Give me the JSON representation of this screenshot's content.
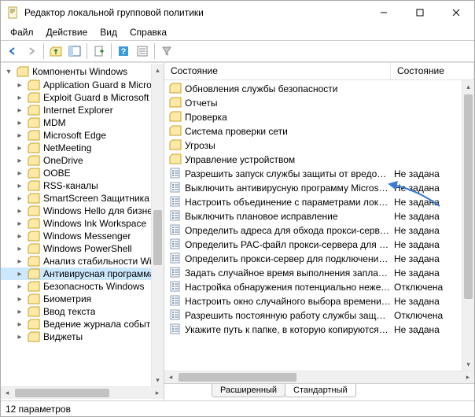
{
  "window": {
    "title": "Редактор локальной групповой политики",
    "minimize": "—",
    "maximize": "☐",
    "close": "✕"
  },
  "menu": {
    "file": "Файл",
    "action": "Действие",
    "view": "Вид",
    "help": "Справка"
  },
  "tree": {
    "root": "Компоненты Windows",
    "items": [
      {
        "label": "Application Guard в Micros"
      },
      {
        "label": "Exploit Guard в Microsoft D"
      },
      {
        "label": "Internet Explorer"
      },
      {
        "label": "MDM"
      },
      {
        "label": "Microsoft Edge"
      },
      {
        "label": "NetMeeting"
      },
      {
        "label": "OneDrive"
      },
      {
        "label": "OOBE"
      },
      {
        "label": "RSS-каналы"
      },
      {
        "label": "SmartScreen Защитника W"
      },
      {
        "label": "Windows Hello для бизнеса"
      },
      {
        "label": "Windows Ink Workspace"
      },
      {
        "label": "Windows Messenger"
      },
      {
        "label": "Windows PowerShell"
      },
      {
        "label": "Анализ стабильности Winc"
      },
      {
        "label": "Антивирусная программа",
        "selected": true
      },
      {
        "label": "Безопасность Windows"
      },
      {
        "label": "Биометрия"
      },
      {
        "label": "Ввод текста"
      },
      {
        "label": "Ведение журнала событий"
      },
      {
        "label": "Виджеты"
      }
    ]
  },
  "list": {
    "col_name": "Состояние",
    "col_state": "Состояние",
    "folders": [
      {
        "name": "Обновления службы безопасности"
      },
      {
        "name": "Отчеты"
      },
      {
        "name": "Проверка"
      },
      {
        "name": "Система проверки сети"
      },
      {
        "name": "Угрозы"
      },
      {
        "name": "Управление устройством"
      }
    ],
    "settings": [
      {
        "name": "Разрешить запуск службы защиты от вредонос...",
        "state": "Не задана"
      },
      {
        "name": "Выключить антивирусную программу Microsof...",
        "state": "Не задана"
      },
      {
        "name": "Настроить объединение с параметрами локаль...",
        "state": "Не задана"
      },
      {
        "name": "Выключить плановое исправление",
        "state": "Не задана"
      },
      {
        "name": "Определить адреса для обхода прокси-сервера",
        "state": "Не задана"
      },
      {
        "name": "Определить PAC-файл прокси-сервера для под...",
        "state": "Не задана"
      },
      {
        "name": "Определить прокси-сервер для подключения к...",
        "state": "Не задана"
      },
      {
        "name": "Задать случайное время выполнения запланир...",
        "state": "Не задана"
      },
      {
        "name": "Настройка обнаружения потенциально нежела...",
        "state": "Отключена"
      },
      {
        "name": "Настроить окно случайного выбора времени в...",
        "state": "Не задана"
      },
      {
        "name": "Разрешить постоянную работу службы защит...",
        "state": "Отключена"
      },
      {
        "name": "Укажите путь к папке, в которую копируются ф...",
        "state": "Не задана"
      }
    ]
  },
  "tabs": {
    "extended": "Расширенный",
    "standard": "Стандартный"
  },
  "status": {
    "text": "12 параметров"
  }
}
